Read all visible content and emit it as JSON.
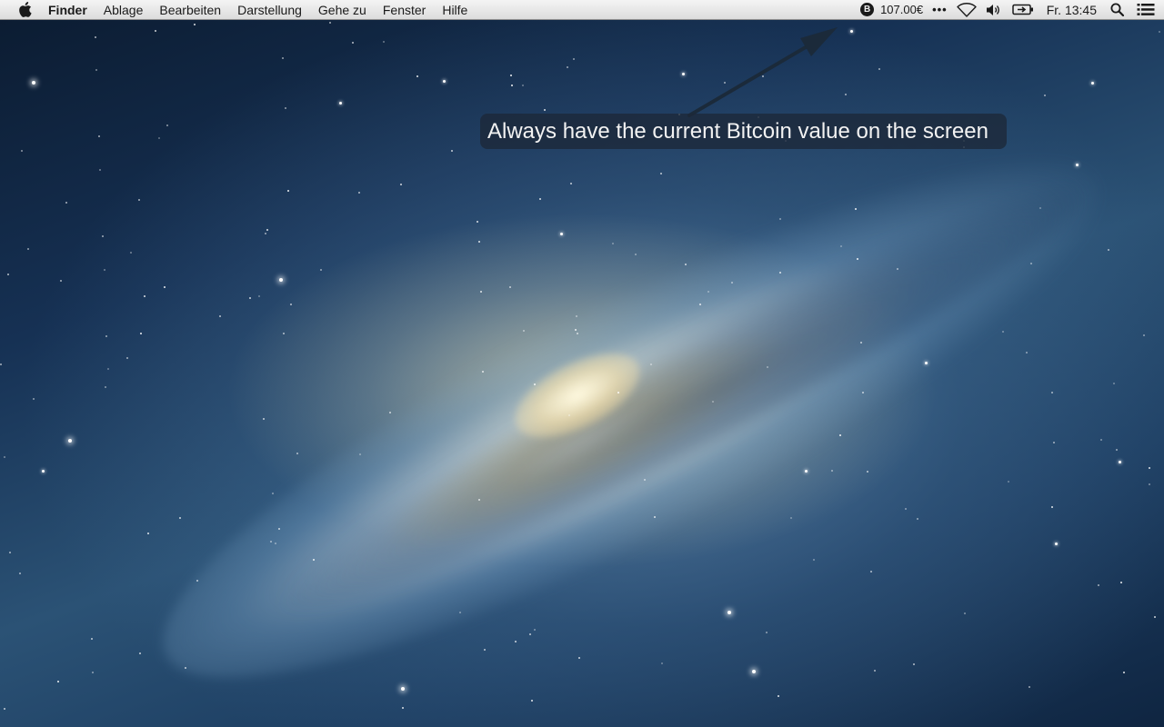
{
  "menubar": {
    "app_name": "Finder",
    "items": [
      {
        "label": "Ablage"
      },
      {
        "label": "Bearbeiten"
      },
      {
        "label": "Darstellung"
      },
      {
        "label": "Gehe zu"
      },
      {
        "label": "Fenster"
      },
      {
        "label": "Hilfe"
      }
    ],
    "status": {
      "bitcoin_symbol": "B",
      "bitcoin_value": "107.00€",
      "more": "•••",
      "clock": "Fr. 13:45"
    },
    "icons": [
      "apple-icon",
      "bitcoin-icon",
      "more-icon",
      "wifi-icon",
      "volume-icon",
      "battery-icon",
      "spotlight-icon",
      "notification-center-icon"
    ]
  },
  "annotation": {
    "text": "Always have the current Bitcoin value on the screen"
  },
  "colors": {
    "menubar_top": "#f4f4f4",
    "menubar_bottom": "#dcdcdc",
    "annotation_bg": "#1c2838",
    "arrow": "#1b2a3a"
  }
}
